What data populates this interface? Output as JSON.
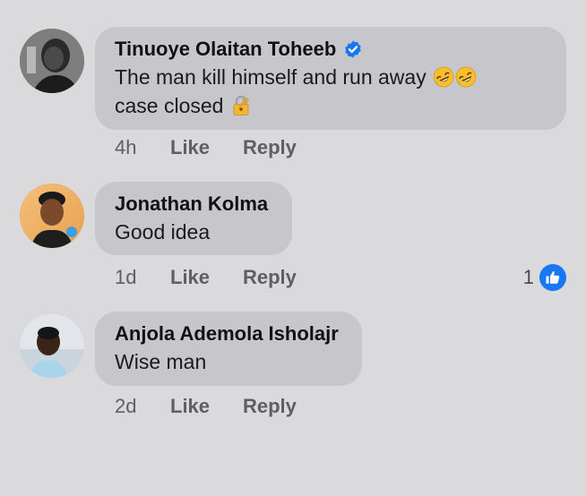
{
  "comments": [
    {
      "author": "Tinuoye Olaitan Toheeb",
      "verified": true,
      "line1": "The man kill himself and run away",
      "line1_emojis": [
        "rolling-on-floor-laughing-emoji",
        "rolling-on-floor-laughing-emoji"
      ],
      "line2": "case closed",
      "line2_emoji": "locked-with-key-emoji",
      "time": "4h",
      "like_label": "Like",
      "reply_label": "Reply"
    },
    {
      "author": "Jonathan Kolma",
      "verified": false,
      "text": "Good idea",
      "time": "1d",
      "like_label": "Like",
      "reply_label": "Reply",
      "reaction_count": "1",
      "reaction_icon": "thumbs-up-icon",
      "reaction_color": "#1877f2"
    },
    {
      "author": "Anjola Ademola Isholajr",
      "verified": false,
      "text": "Wise man",
      "time": "2d",
      "like_label": "Like",
      "reply_label": "Reply"
    }
  ],
  "colors": {
    "background": "#dadadc",
    "bubble": "#c7c7cb",
    "verified_badge": "#1877f2",
    "action_text": "#5f5f63"
  }
}
